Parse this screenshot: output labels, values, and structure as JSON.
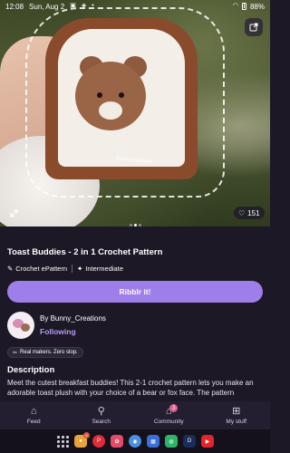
{
  "status_bar": {
    "time": "12:08",
    "date": "Sun, Aug 2",
    "battery": "88%"
  },
  "hero": {
    "likes": "151",
    "watermark": "bunnycreations"
  },
  "product": {
    "title": "Toast Buddies - 2 in 1 Crochet Pattern",
    "tag_type": "Crochet ePattern",
    "tag_level": "Intermediate",
    "cta_label": "Ribblr it!"
  },
  "creator": {
    "by_prefix": "By ",
    "name": "Bunny_Creations",
    "follow_label": "Following",
    "badge": "Real makers. Zero slop."
  },
  "description": {
    "heading": "Description",
    "text": "Meet the cutest breakfast buddies! This 2-1 crochet pattern lets you make an adorable toast plush with your choice of a bear or fox face. The pattern"
  },
  "bottom_nav": {
    "items": [
      {
        "label": "Feed",
        "icon": "home-icon"
      },
      {
        "label": "Search",
        "icon": "search-icon"
      },
      {
        "label": "Community",
        "icon": "community-icon",
        "badge": "3"
      },
      {
        "label": "My stuff",
        "icon": "grid-icon"
      }
    ]
  },
  "taskbar": {
    "apps": [
      {
        "icon": "app-drawer-icon"
      },
      {
        "icon": "chat-app-icon",
        "color": "#e8a33a",
        "badge": "9"
      },
      {
        "icon": "pinterest-icon",
        "color": "#e02b3a"
      },
      {
        "icon": "craft-app-icon",
        "color": "#e44b6a"
      },
      {
        "icon": "chrome-icon",
        "color": "#4a8fe0"
      },
      {
        "icon": "calendar-icon",
        "color": "#3b6fd8"
      },
      {
        "icon": "messenger-icon",
        "color": "#2bb46a"
      },
      {
        "icon": "disney-icon",
        "color": "#1a2c5c"
      },
      {
        "icon": "youtube-icon",
        "color": "#e3242b"
      }
    ]
  }
}
